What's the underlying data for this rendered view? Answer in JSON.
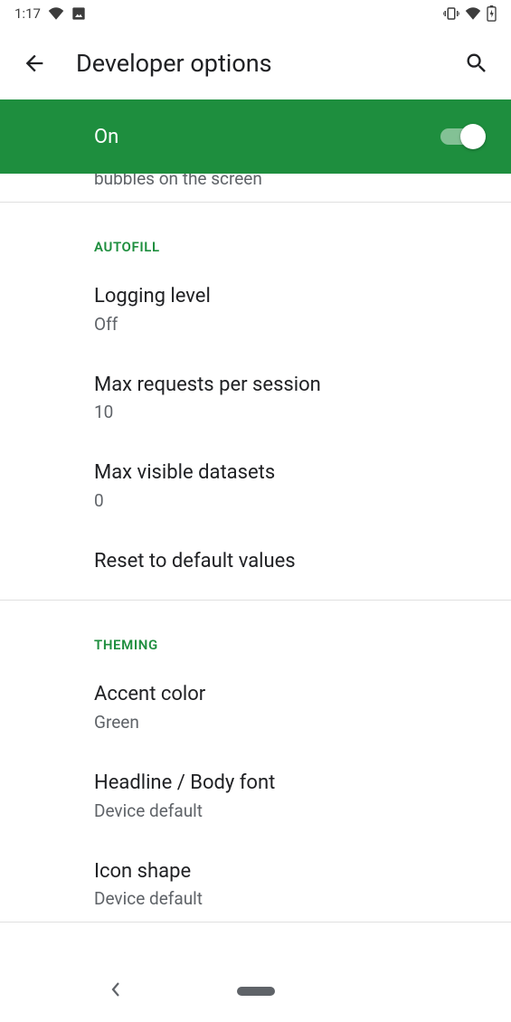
{
  "status_bar": {
    "time": "1:17"
  },
  "app_bar": {
    "title": "Developer options"
  },
  "master_toggle": {
    "label": "On",
    "state": "on"
  },
  "cutoff_row": {
    "partial_text": "bubbles on the screen"
  },
  "sections": [
    {
      "header": "AUTOFILL",
      "items": [
        {
          "title": "Logging level",
          "sub": "Off"
        },
        {
          "title": "Max requests per session",
          "sub": "10"
        },
        {
          "title": "Max visible datasets",
          "sub": "0"
        },
        {
          "title": "Reset to default values"
        }
      ]
    },
    {
      "header": "THEMING",
      "items": [
        {
          "title": "Accent color",
          "sub": "Green"
        },
        {
          "title": "Headline / Body font",
          "sub": "Device default"
        },
        {
          "title": "Icon shape",
          "sub": "Device default"
        }
      ]
    }
  ]
}
